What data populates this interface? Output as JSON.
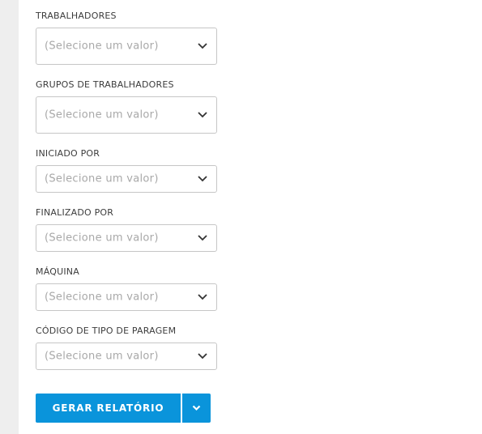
{
  "filters": [
    {
      "label": "TRABALHADORES",
      "placeholder": "(Selecione um valor)"
    },
    {
      "label": "GRUPOS DE TRABALHADORES",
      "placeholder": "(Selecione um valor)"
    },
    {
      "label": "INICIADO POR",
      "placeholder": "(Selecione um valor)"
    },
    {
      "label": "FINALIZADO POR",
      "placeholder": "(Selecione um valor)"
    },
    {
      "label": "MÁQUINA",
      "placeholder": "(Selecione um valor)"
    },
    {
      "label": "CÓDIGO DE TIPO DE PARAGEM",
      "placeholder": "(Selecione um valor)"
    }
  ],
  "actions": {
    "generate_label": "GERAR RELATÓRIO",
    "dropdown_icon": "chevron-down-icon"
  },
  "colors": {
    "accent": "#0a94db",
    "sidebar": "#eeeeee"
  }
}
